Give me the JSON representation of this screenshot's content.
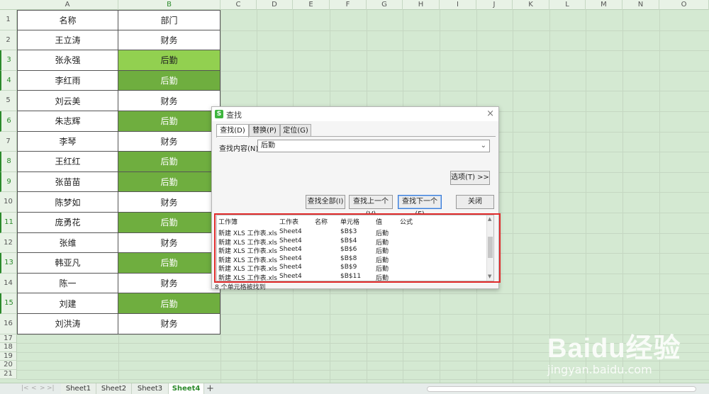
{
  "columns": [
    "A",
    "B",
    "C",
    "D",
    "E",
    "F",
    "G",
    "H",
    "I",
    "J",
    "K",
    "L",
    "M",
    "N",
    "O"
  ],
  "rows": [
    "1",
    "2",
    "3",
    "4",
    "5",
    "6",
    "7",
    "8",
    "9",
    "10",
    "11",
    "12",
    "13",
    "14",
    "15",
    "16",
    "17",
    "18",
    "19",
    "20",
    "21"
  ],
  "table": {
    "header": {
      "name": "名称",
      "dept": "部门"
    },
    "rows": [
      {
        "name": "王立涛",
        "dept": "财务",
        "hl": false
      },
      {
        "name": "张永强",
        "dept": "后勤",
        "hl": true,
        "active": true
      },
      {
        "name": "李红雨",
        "dept": "后勤",
        "hl": true
      },
      {
        "name": "刘云美",
        "dept": "财务",
        "hl": false
      },
      {
        "name": "朱志辉",
        "dept": "后勤",
        "hl": true
      },
      {
        "name": "李琴",
        "dept": "财务",
        "hl": false
      },
      {
        "name": "王红红",
        "dept": "后勤",
        "hl": true
      },
      {
        "name": "张苗苗",
        "dept": "后勤",
        "hl": true
      },
      {
        "name": "陈梦如",
        "dept": "财务",
        "hl": false
      },
      {
        "name": "庞勇花",
        "dept": "后勤",
        "hl": true
      },
      {
        "name": "张维",
        "dept": "财务",
        "hl": false
      },
      {
        "name": "韩亚凡",
        "dept": "后勤",
        "hl": true
      },
      {
        "name": "陈一",
        "dept": "财务",
        "hl": false
      },
      {
        "name": "刘建",
        "dept": "后勤",
        "hl": true
      },
      {
        "name": "刘洪涛",
        "dept": "财务",
        "hl": false
      }
    ]
  },
  "dialog": {
    "title": "查找",
    "logo": "S",
    "close_icon": "×",
    "tabs": [
      "查找(D)",
      "替换(P)",
      "定位(G)"
    ],
    "find_label": "查找内容(N):",
    "find_value": "后勤",
    "chevron": "⌄",
    "options_btn": "选项(T) >>",
    "find_all_btn": "查找全部(I)",
    "find_prev_btn": "查找上一个(V)",
    "find_next_btn": "查找下一个(F)",
    "close_btn": "关闭",
    "results_header": [
      "工作簿",
      "工作表",
      "名称",
      "单元格",
      "值",
      "公式"
    ],
    "results": [
      {
        "book": "新建 XLS 工作表.xls",
        "sheet": "Sheet4",
        "cell": "$B$3",
        "value": "后勤"
      },
      {
        "book": "新建 XLS 工作表.xls",
        "sheet": "Sheet4",
        "cell": "$B$4",
        "value": "后勤"
      },
      {
        "book": "新建 XLS 工作表.xls",
        "sheet": "Sheet4",
        "cell": "$B$6",
        "value": "后勤"
      },
      {
        "book": "新建 XLS 工作表.xls",
        "sheet": "Sheet4",
        "cell": "$B$8",
        "value": "后勤"
      },
      {
        "book": "新建 XLS 工作表.xls",
        "sheet": "Sheet4",
        "cell": "$B$9",
        "value": "后勤"
      },
      {
        "book": "新建 XLS 工作表.xls",
        "sheet": "Sheet4",
        "cell": "$B$11",
        "value": "后勤"
      }
    ],
    "status": "8 个单元格被找到"
  },
  "sheets": [
    "Sheet1",
    "Sheet2",
    "Sheet3",
    "Sheet4"
  ],
  "active_sheet": "Sheet4",
  "add_sheet_icon": "+",
  "nav_arrows": [
    "|<",
    "<",
    ">",
    ">|"
  ],
  "watermark": {
    "text": "Baidu经验",
    "sub": "jingyan.baidu.com"
  },
  "colors": {
    "highlight": "#6fae3f",
    "highlight_active": "#92d050",
    "frame": "#e12b2b",
    "accent": "#2b8a2b"
  }
}
